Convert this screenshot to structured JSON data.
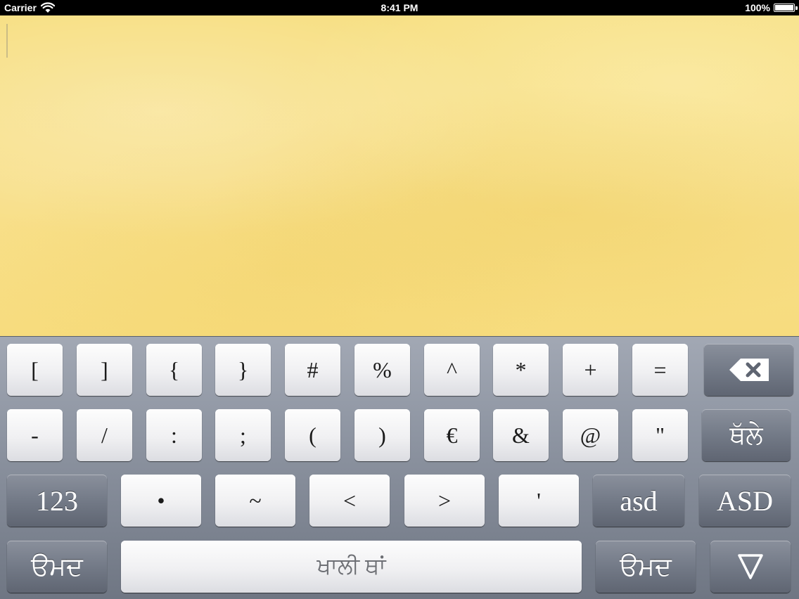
{
  "status_bar": {
    "carrier": "Carrier",
    "time": "8:41 PM",
    "battery": "100%",
    "battery_level": 1.0,
    "icons": [
      "wifi-icon",
      "battery-icon"
    ]
  },
  "text_area": {
    "value": ""
  },
  "keyboard": {
    "row1": [
      "[",
      "]",
      "{",
      "}",
      "#",
      "%",
      "^",
      "*",
      "+",
      "="
    ],
    "row1_delete_icon": "backspace-icon",
    "row2": [
      "-",
      "/",
      ":",
      ";",
      "(",
      ")",
      "€",
      "&",
      "@",
      "\""
    ],
    "row2_enter": "ਥੱਲੇ",
    "row3_numbers": "123",
    "row3": [
      "•",
      "~",
      "<",
      ">",
      "'"
    ],
    "row3_lower": "asd",
    "row3_upper": "ASD",
    "row4_left": "ੳਮਦ",
    "row4_space": "ਖਾਲੀ ਥਾਂ",
    "row4_right": "ੳਮਦ",
    "row4_dismiss_icon": "hide-keyboard-icon"
  },
  "colors": {
    "paper": "#f7df82",
    "keyboard_bg": "#8f96a3",
    "key_light": "#f0f0f2",
    "key_dark": "#737a87"
  }
}
